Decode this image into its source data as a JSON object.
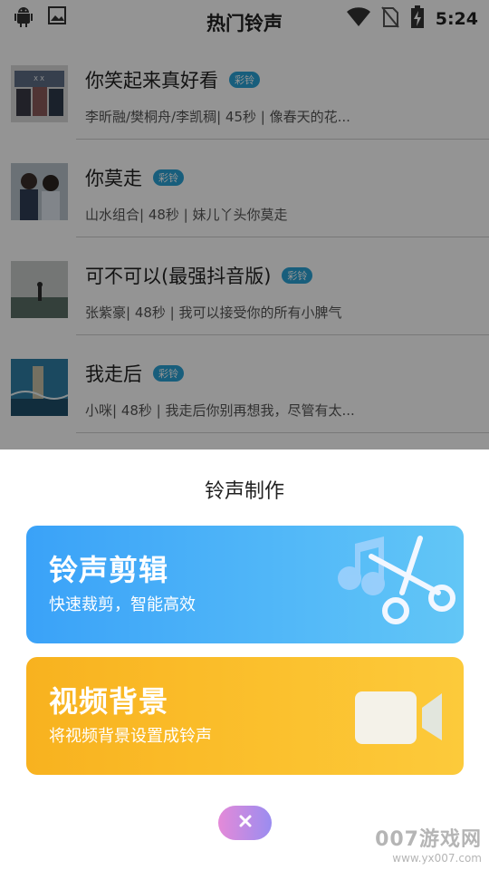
{
  "status_bar": {
    "time": "5:24",
    "left_icons": [
      "android-icon",
      "image-icon"
    ],
    "right_icons": [
      "wifi-icon",
      "no-sim-icon",
      "battery-charging-icon"
    ]
  },
  "header": {
    "title": "热门铃声"
  },
  "songs": [
    {
      "title": "你笑起来真好看",
      "badge": "彩铃",
      "meta": "李昕融/樊桐舟/李凯稠| 45秒 |  像春天的花..."
    },
    {
      "title": "你莫走",
      "badge": "彩铃",
      "meta": "山水组合| 48秒 |  妹儿丫头你莫走"
    },
    {
      "title": "可不可以(最强抖音版)",
      "badge": "彩铃",
      "meta": "张紫豪| 48秒 |  我可以接受你的所有小脾气"
    },
    {
      "title": "我走后",
      "badge": "彩铃",
      "meta": "小咪| 48秒 |  我走后你别再想我，尽管有太..."
    }
  ],
  "sheet": {
    "title": "铃声制作",
    "cards": [
      {
        "title": "铃声剪辑",
        "subtitle": "快速裁剪，智能高效",
        "icon": "music-scissors-icon",
        "color": "#3aa2f8"
      },
      {
        "title": "视频背景",
        "subtitle": "将视频背景设置成铃声",
        "icon": "video-camera-icon",
        "color": "#f8b21f"
      }
    ],
    "close_icon": "close-icon"
  },
  "watermark": {
    "line1": "007游戏网",
    "line2": "www.yx007.com"
  }
}
